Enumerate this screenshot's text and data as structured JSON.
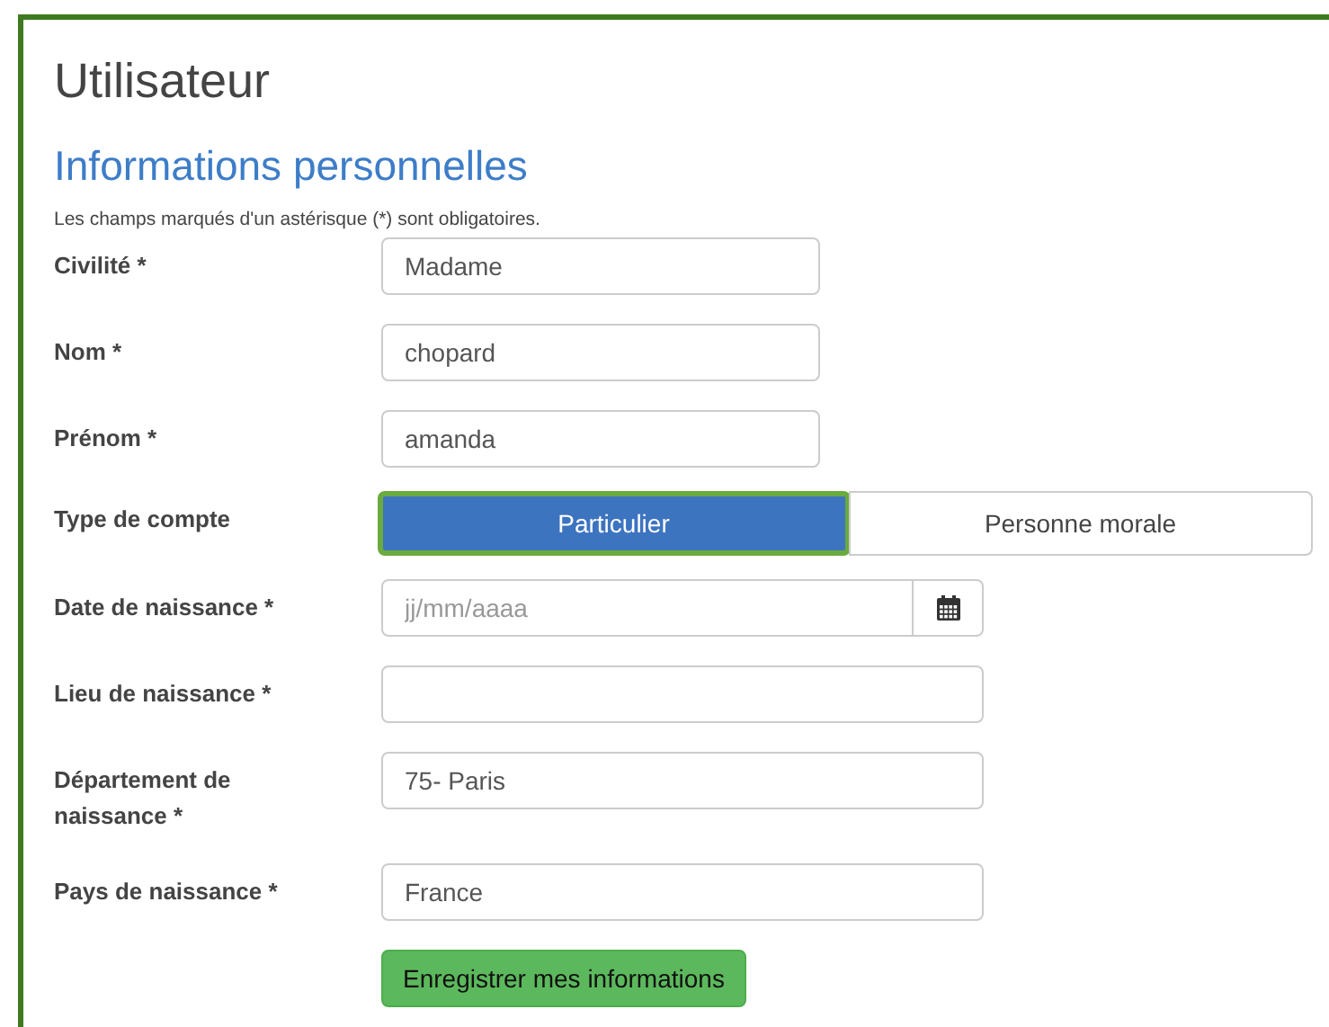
{
  "title": "Utilisateur",
  "section": {
    "heading": "Informations personnelles",
    "note": "Les champs marqués d'un astérisque (*) sont obligatoires."
  },
  "fields": [
    {
      "kind": "short_text",
      "label": "Civilité *",
      "value": "Madame"
    },
    {
      "kind": "short_text",
      "label": "Nom *",
      "value": "chopard"
    },
    {
      "kind": "short_text",
      "label": "Prénom *",
      "value": "amanda"
    },
    {
      "kind": "toggle",
      "label": "Type de compte",
      "options": [
        {
          "label": "Particulier",
          "selected": true
        },
        {
          "label": "Personne morale",
          "selected": false
        }
      ]
    },
    {
      "kind": "date",
      "label": "Date de naissance *",
      "placeholder": "jj/mm/aaaa"
    },
    {
      "kind": "text",
      "label": "Lieu de naissance *"
    },
    {
      "kind": "text",
      "label": "Département de naissance *",
      "value": "75- Paris"
    },
    {
      "kind": "text",
      "label": "Pays de naissance *",
      "value": "France"
    }
  ],
  "submit": "Enregistrer mes informations"
}
